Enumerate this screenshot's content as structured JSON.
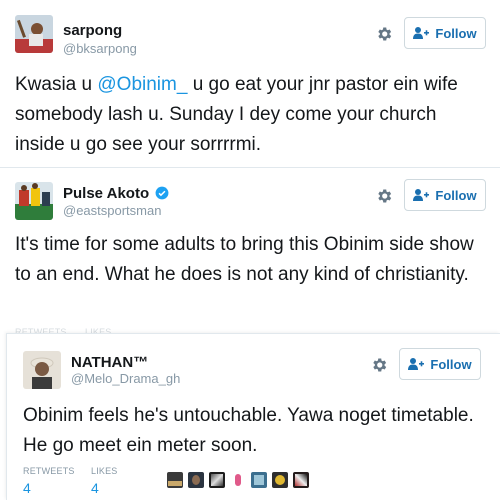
{
  "tweets": [
    {
      "name": "sarpong",
      "handle": "@bksarpong",
      "follow_label": "Follow",
      "text_before": "Kwasia u ",
      "mention": "@Obinim_",
      "text_after": " u go eat your jnr pastor ein wife somebody lash u. Sunday I dey come your church inside u go see your sorrrrmi."
    },
    {
      "name": "Pulse Akoto",
      "verified": true,
      "handle": "@eastsportsman",
      "follow_label": "Follow",
      "text": "It's time for some adults to bring this Obinim side show to an end. What he does is not any kind of christianity.",
      "stats_labels_partial": [
        "RETWEETS",
        "LIKES"
      ]
    },
    {
      "name": "NATHAN™",
      "handle": "@Melo_Drama_gh",
      "follow_label": "Follow",
      "text": "Obinim feels he's untouchable. Yawa noget timetable. He go meet ein meter soon.",
      "retweets_label": "RETWEETS",
      "retweets": "4",
      "likes_label": "LIKES",
      "likes": "4"
    }
  ],
  "icons": {
    "gear": "gear-icon",
    "follow": "add-user-icon",
    "verified": "verified-badge-icon"
  },
  "colors": {
    "link": "#1b95e0",
    "follow_text": "#1a6fb0",
    "secondary": "#8899a6",
    "verified": "#1da1f2"
  }
}
